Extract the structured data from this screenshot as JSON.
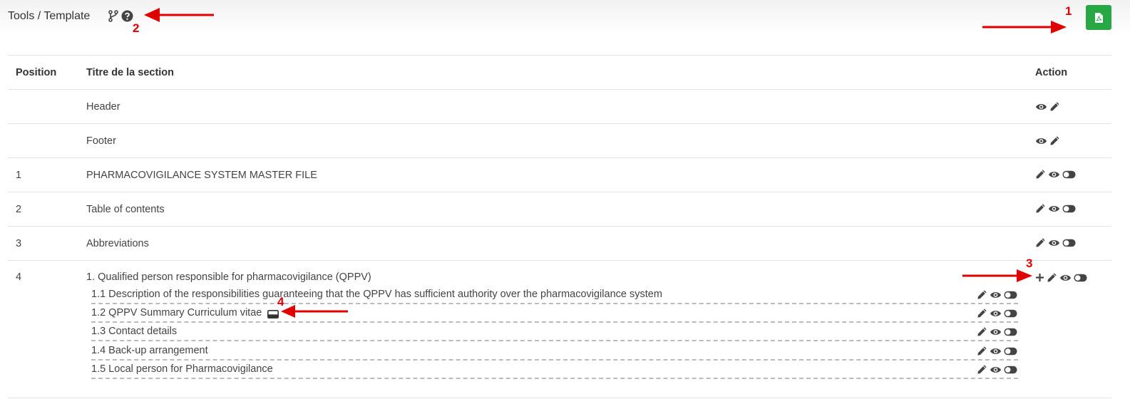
{
  "header": {
    "breadcrumb": "Tools / Template",
    "icons": [
      "branch-icon",
      "help-icon"
    ],
    "export_icon": "pdf-file-icon",
    "export_color": "#27a844"
  },
  "table": {
    "columns": [
      "Position",
      "Titre de la section",
      "Action"
    ],
    "rows": [
      {
        "position": "",
        "title": "Header",
        "actions": [
          "eye-icon",
          "pencil-icon"
        ]
      },
      {
        "position": "",
        "title": "Footer",
        "actions": [
          "eye-icon",
          "pencil-icon"
        ]
      },
      {
        "position": "1",
        "title": "PHARMACOVIGILANCE SYSTEM MASTER FILE",
        "actions": [
          "pencil-icon",
          "eye-icon",
          "toggle-icon"
        ]
      },
      {
        "position": "2",
        "title": "Table of contents",
        "actions": [
          "pencil-icon",
          "eye-icon",
          "toggle-icon"
        ]
      },
      {
        "position": "3",
        "title": "Abbreviations",
        "actions": [
          "pencil-icon",
          "eye-icon",
          "toggle-icon"
        ]
      },
      {
        "position": "4",
        "title": "1. Qualified person responsible for pharmacovigilance (QPPV)",
        "actions": [
          "plus-icon",
          "pencil-icon",
          "eye-icon",
          "toggle-icon"
        ],
        "subsections": [
          {
            "title": "1.1 Description of the responsibilities guaranteeing that the QPPV has sufficient authority over the pharmacovigilance system"
          },
          {
            "title": "1.2 QPPV Summary Curriculum vitae",
            "badge_icon": "id-card-icon"
          },
          {
            "title": "1.3 Contact details"
          },
          {
            "title": "1.4 Back-up arrangement"
          },
          {
            "title": "1.5 Local person for Pharmacovigilance"
          }
        ]
      }
    ]
  },
  "annotations": {
    "labels": [
      "1",
      "2",
      "3",
      "4"
    ],
    "color": "#e00000"
  }
}
